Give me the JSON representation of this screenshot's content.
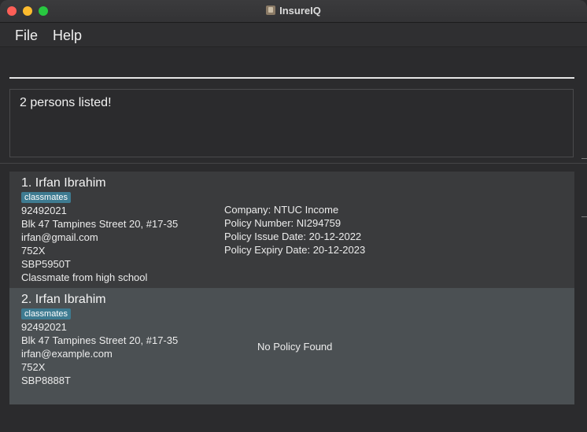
{
  "window": {
    "title": "InsureIQ"
  },
  "menu": {
    "file": "File",
    "help": "Help"
  },
  "command": {
    "value": ""
  },
  "result": {
    "text": "2 persons listed!"
  },
  "persons": [
    {
      "name": "1.  Irfan Ibrahim",
      "tag": "classmates",
      "phone": "92492021",
      "address": "Blk 47 Tampines Street 20, #17-35",
      "email": "irfan@gmail.com",
      "postal": "752X",
      "plate": "SBP5950T",
      "remark": "Classmate from high school",
      "policy": {
        "company": "Company: NTUC Income",
        "number": "Policy Number: NI294759",
        "issue": "Policy Issue Date: 20-12-2022",
        "expiry": "Policy Expiry Date: 20-12-2023"
      }
    },
    {
      "name": "2.  Irfan Ibrahim",
      "tag": "classmates",
      "phone": "92492021",
      "address": "Blk 47 Tampines Street 20, #17-35",
      "email": "irfan@example.com",
      "postal": "752X",
      "plate": "SBP8888T",
      "no_policy": "No Policy Found"
    }
  ]
}
